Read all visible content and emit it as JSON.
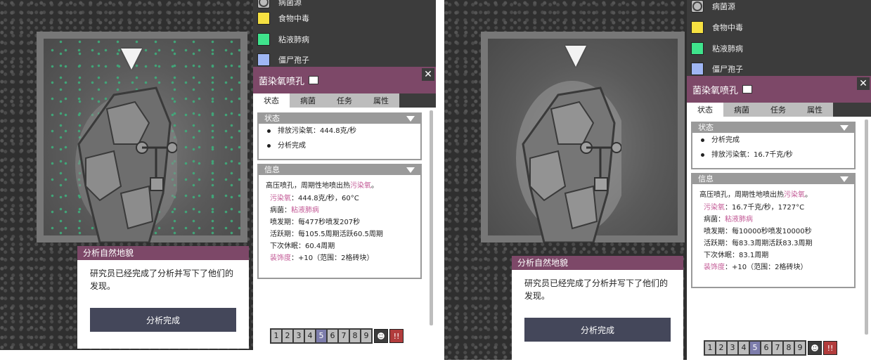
{
  "legend": [
    {
      "label": "病菌源",
      "color": "#bbbbbb",
      "type": "icon"
    },
    {
      "label": "食物中毒",
      "color": "#f5e041"
    },
    {
      "label": "粘液肺病",
      "color": "#3fe38c"
    },
    {
      "label": "僵尸孢子",
      "color": "#9fb6f4"
    }
  ],
  "panel": {
    "title": "菌染氧喷孔",
    "close": "✕",
    "tabs": [
      "状态",
      "病菌",
      "任务",
      "属性"
    ],
    "status_header": "状态",
    "info_header": "信息",
    "desc_prefix": "高压喷孔，周期性地喷出热",
    "desc_link": "污染氧",
    "desc_suffix": "。",
    "germ_label": "病菌：",
    "germ_value": "粘液肺病",
    "decor_label": "装饰度",
    "decor_value": "：+10（范围：2格砖块）"
  },
  "left": {
    "status": [
      "排放污染氧：444.8克/秒",
      "分析完成"
    ],
    "gas_label": "污染氧",
    "gas_value": "：444.8克/秒，60°C",
    "eruption": "喷发期：每477秒喷发207秒",
    "active": "活跃期：每105.5周期活跃60.5周期",
    "dormant": "下次休眠：60.4周期"
  },
  "right": {
    "legend_first": "病菌源",
    "status": [
      "分析完成",
      "排放污染氧：16.7千克/秒"
    ],
    "gas_label": "污染氧",
    "gas_value": "：16.7千克/秒，1727°C",
    "eruption": "喷发期：每10000秒喷发10000秒",
    "active": "活跃期：每83.3周期活跃83.3周期",
    "dormant": "下次休眠：83.1周期"
  },
  "speed": {
    "numbers": [
      "1",
      "2",
      "3",
      "4",
      "5",
      "6",
      "7",
      "8",
      "9"
    ],
    "active_index": 4,
    "alert": "!!"
  },
  "dialog": {
    "title": "分析自然地貌",
    "body": "研究员已经完成了分析并写下了他们的发现。",
    "button": "分析完成"
  },
  "colors": {
    "title_bar": "#7d4868",
    "germ_dots": "#3fae7c",
    "link_pink": "#c35a96",
    "speed_active": "#7d7dac"
  }
}
